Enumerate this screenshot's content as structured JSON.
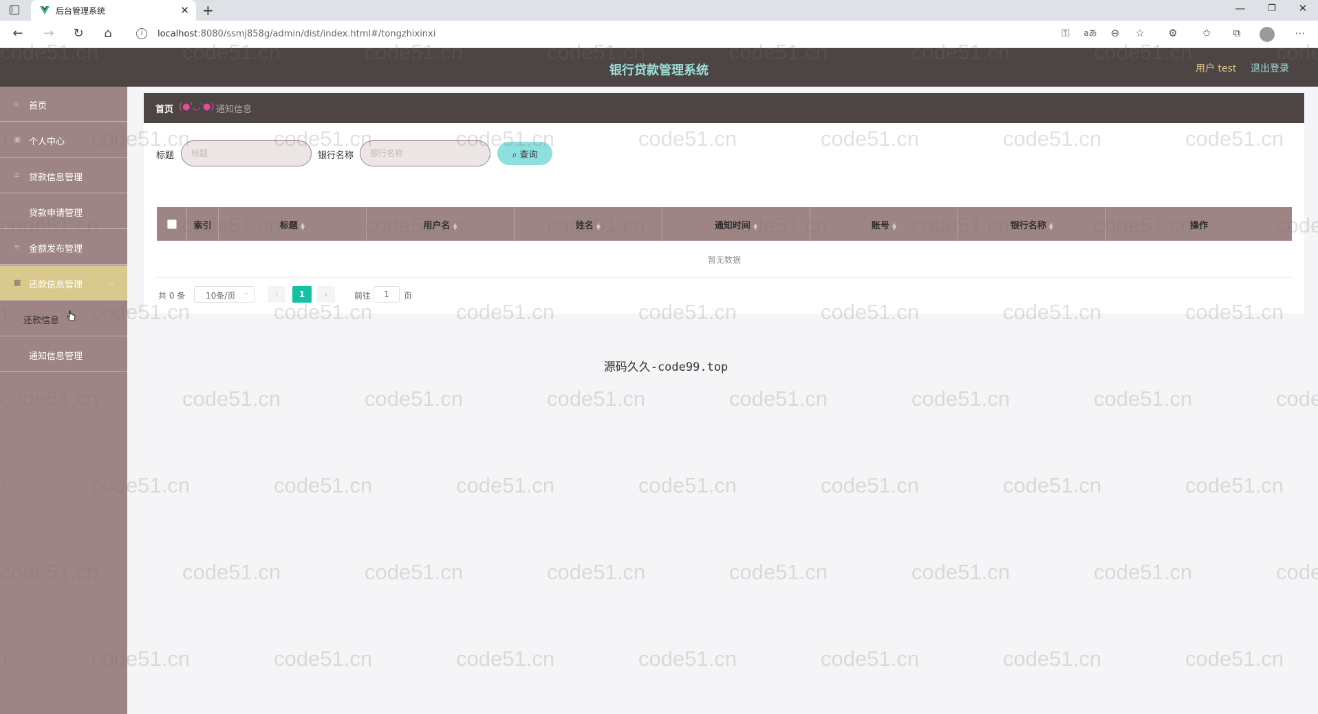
{
  "browser": {
    "tab_title": "后台管理系统",
    "url_host": "localhost",
    "url_rest": ":8080/ssmj858g/admin/dist/index.html#/tongzhixinxi"
  },
  "header": {
    "title": "银行贷款管理系统",
    "user_label": "用户 test",
    "logout": "退出登录"
  },
  "sidebar": {
    "items": [
      {
        "label": "首页",
        "icon": "home-icon"
      },
      {
        "label": "个人中心",
        "icon": "user-icon"
      },
      {
        "label": "贷款信息管理",
        "icon": "menu-icon"
      },
      {
        "label": "贷款申请管理",
        "icon": ""
      },
      {
        "label": "金额发布管理",
        "icon": "menu-icon"
      },
      {
        "label": "还款信息管理",
        "icon": "grid-icon",
        "expanded": true
      },
      {
        "label": "还款信息",
        "sub": true
      },
      {
        "label": "通知信息管理",
        "sub": true
      }
    ]
  },
  "breadcrumb": {
    "home": "首页",
    "separator": "(●'◡'●)",
    "current": "通知信息"
  },
  "filters": {
    "title_label": "标题",
    "title_placeholder": "标题",
    "bank_label": "银行名称",
    "bank_placeholder": "银行名称",
    "search_button": "查询"
  },
  "table": {
    "columns": [
      "索引",
      "标题",
      "用户名",
      "姓名",
      "通知时间",
      "账号",
      "银行名称",
      "操作"
    ],
    "empty_text": "暂无数据"
  },
  "pagination": {
    "total": "共 0 条",
    "page_size": "10条/页",
    "current_page": "1",
    "goto_label": "前往",
    "goto_value": "1",
    "page_suffix": "页"
  },
  "footer": {
    "text": "源码久久-code99.top"
  },
  "watermark": "code51.cn",
  "colors": {
    "header_bg": "#4d4444",
    "sidebar_bg": "#9e8585",
    "active_item": "#d9c98c",
    "title_color": "#9cded9",
    "page_active": "#13c2a3"
  }
}
